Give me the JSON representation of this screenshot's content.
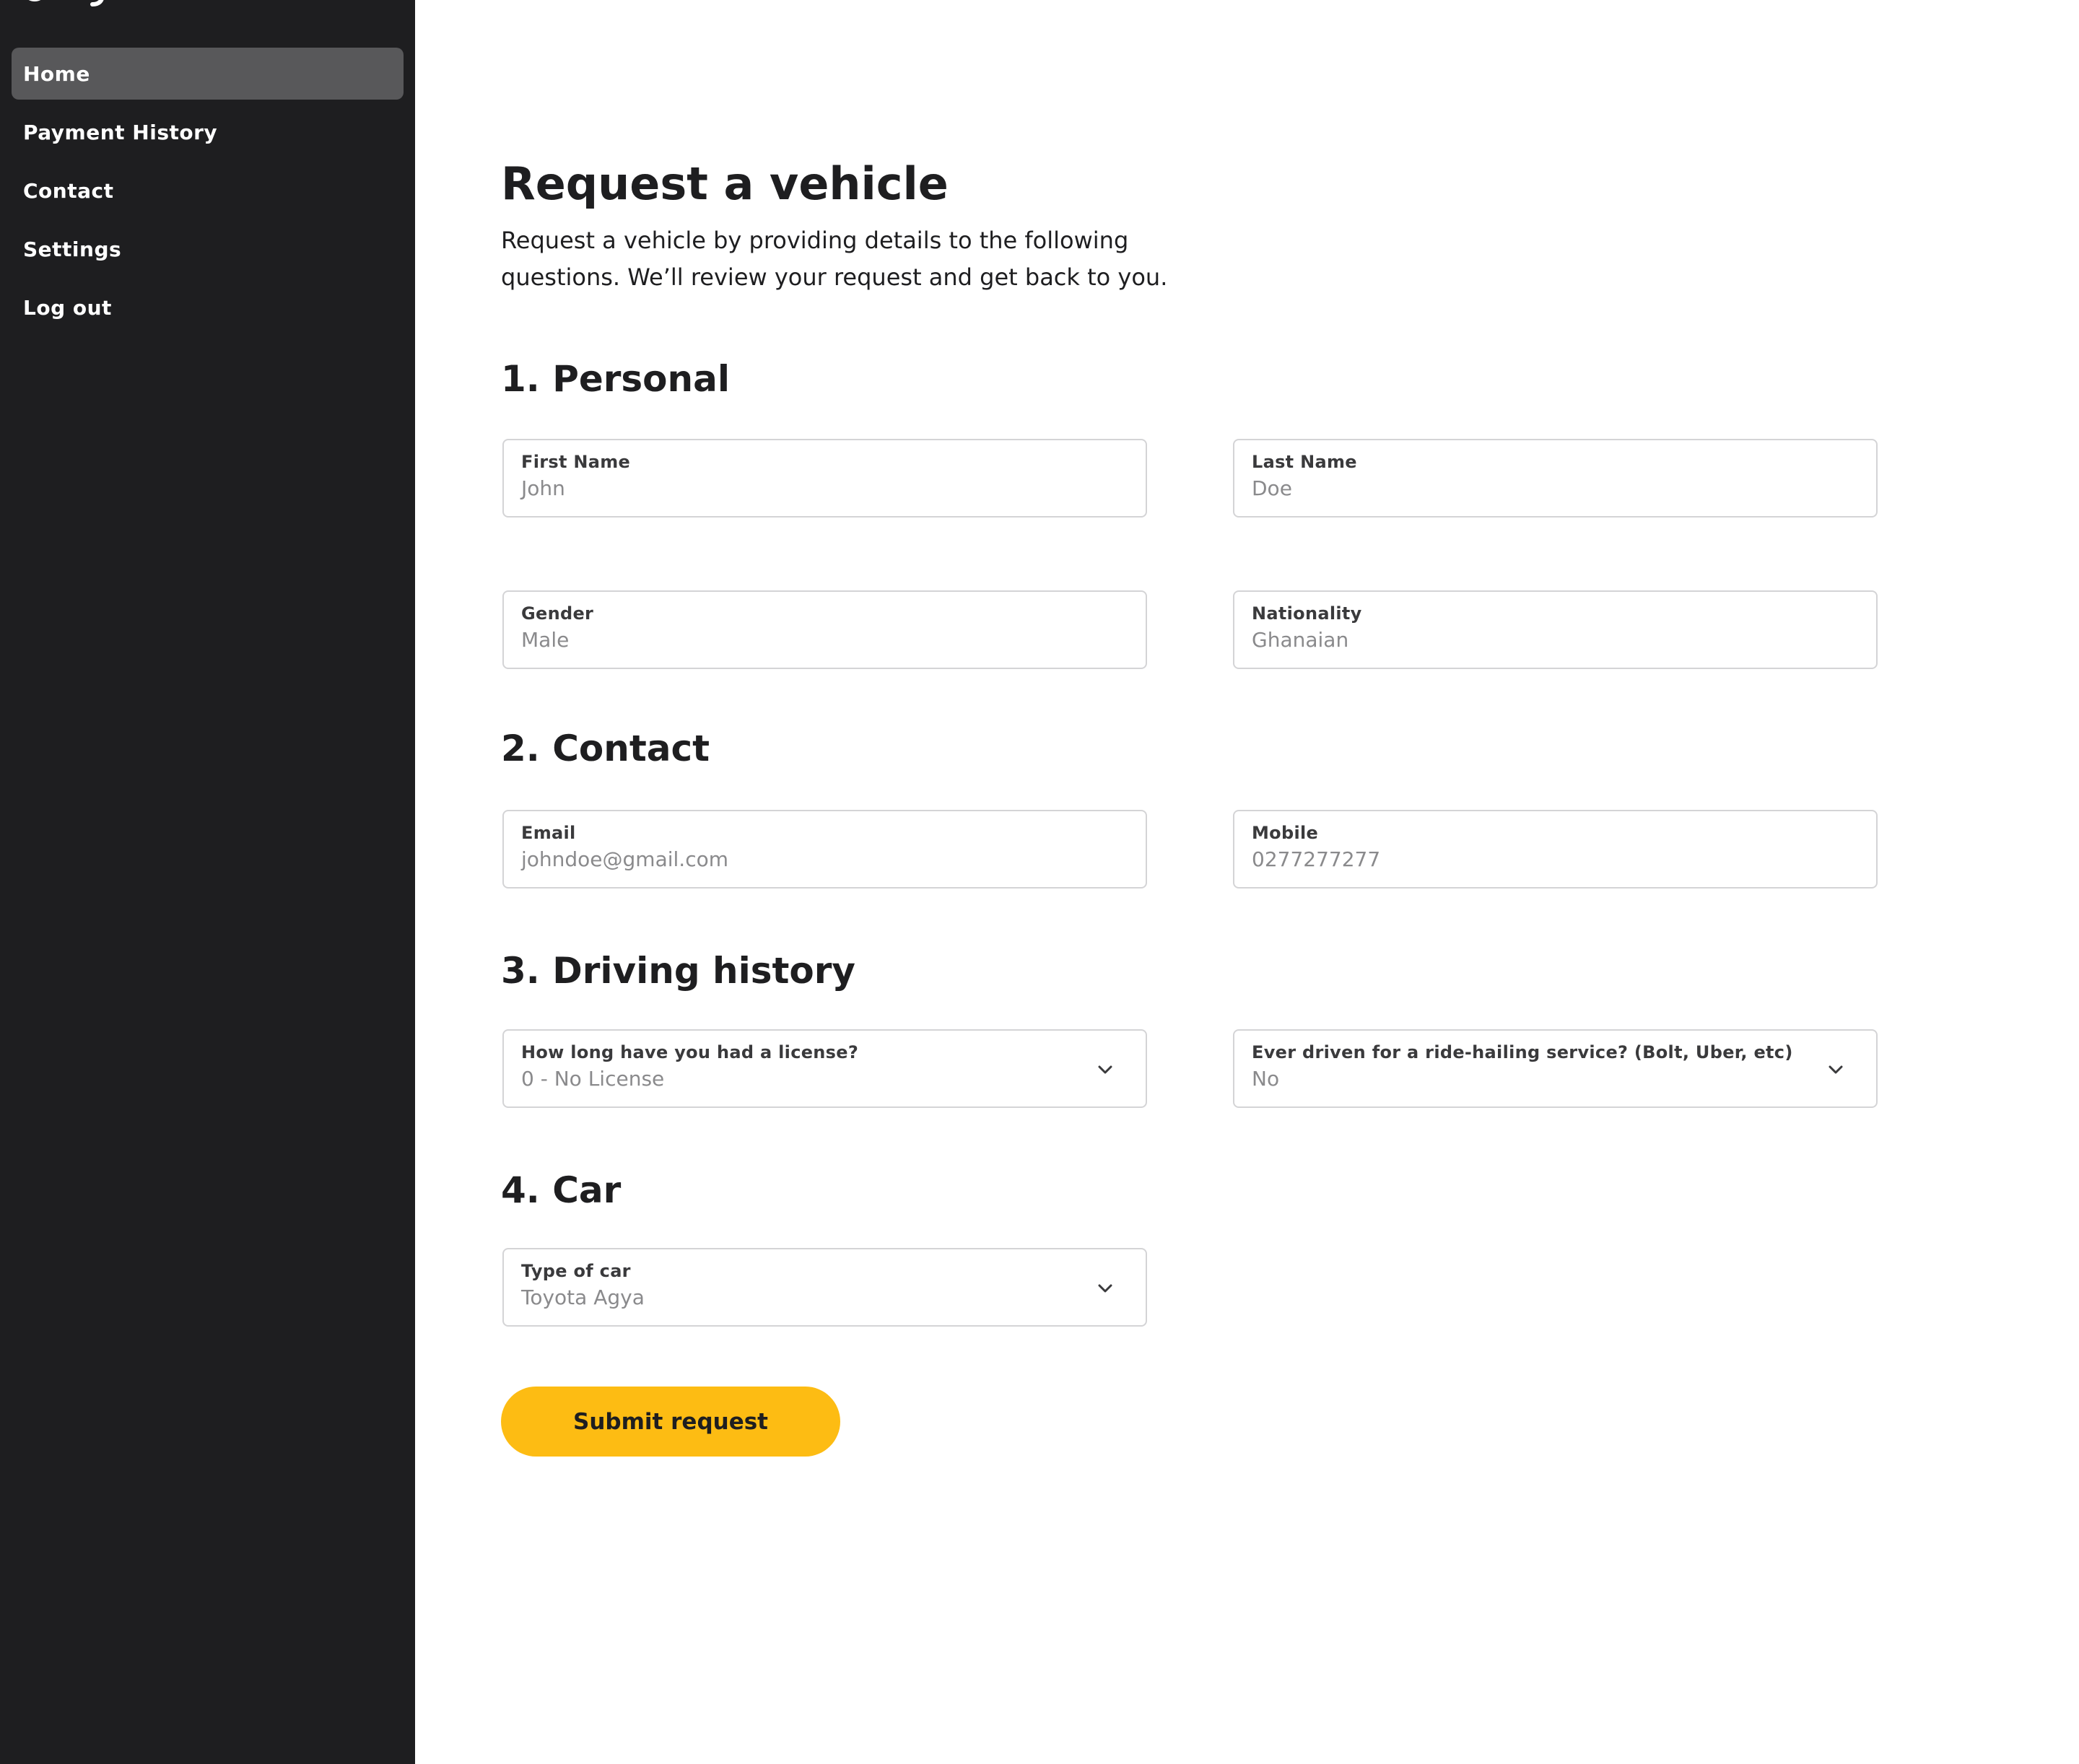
{
  "sidebar": {
    "items": [
      {
        "label": "Home",
        "active": true
      },
      {
        "label": "Payment History",
        "active": false
      },
      {
        "label": "Contact",
        "active": false
      },
      {
        "label": "Settings",
        "active": false
      },
      {
        "label": "Log out",
        "active": false
      }
    ]
  },
  "page": {
    "title": "Request a vehicle",
    "description": "Request a vehicle by providing details to the following questions. We’ll review your request and get back to you."
  },
  "sections": {
    "personal": {
      "title": "1. Personal",
      "first_name": {
        "label": "First Name",
        "value": "John"
      },
      "last_name": {
        "label": "Last Name",
        "value": "Doe"
      },
      "gender": {
        "label": "Gender",
        "value": "Male"
      },
      "nationality": {
        "label": "Nationality",
        "value": "Ghanaian"
      }
    },
    "contact": {
      "title": "2. Contact",
      "email": {
        "label": "Email",
        "value": "johndoe@gmail.com"
      },
      "mobile": {
        "label": "Mobile",
        "value": "0277277277"
      }
    },
    "driving": {
      "title": "3. Driving history",
      "license": {
        "label": "How long have you had a license?",
        "value": "0 - No License"
      },
      "ride_hailing": {
        "label": "Ever driven for a ride-hailing service? (Bolt, Uber, etc)",
        "value": "No"
      }
    },
    "car": {
      "title": "4. Car",
      "type": {
        "label": "Type of car",
        "value": "Toyota Agya"
      }
    }
  },
  "submit_label": "Submit request",
  "colors": {
    "sidebar_bg": "#1e1e20",
    "active_nav_bg": "#58585a",
    "accent": "#fdbc13",
    "field_border": "#d4d4d6",
    "value_text": "#8a8a8c"
  }
}
